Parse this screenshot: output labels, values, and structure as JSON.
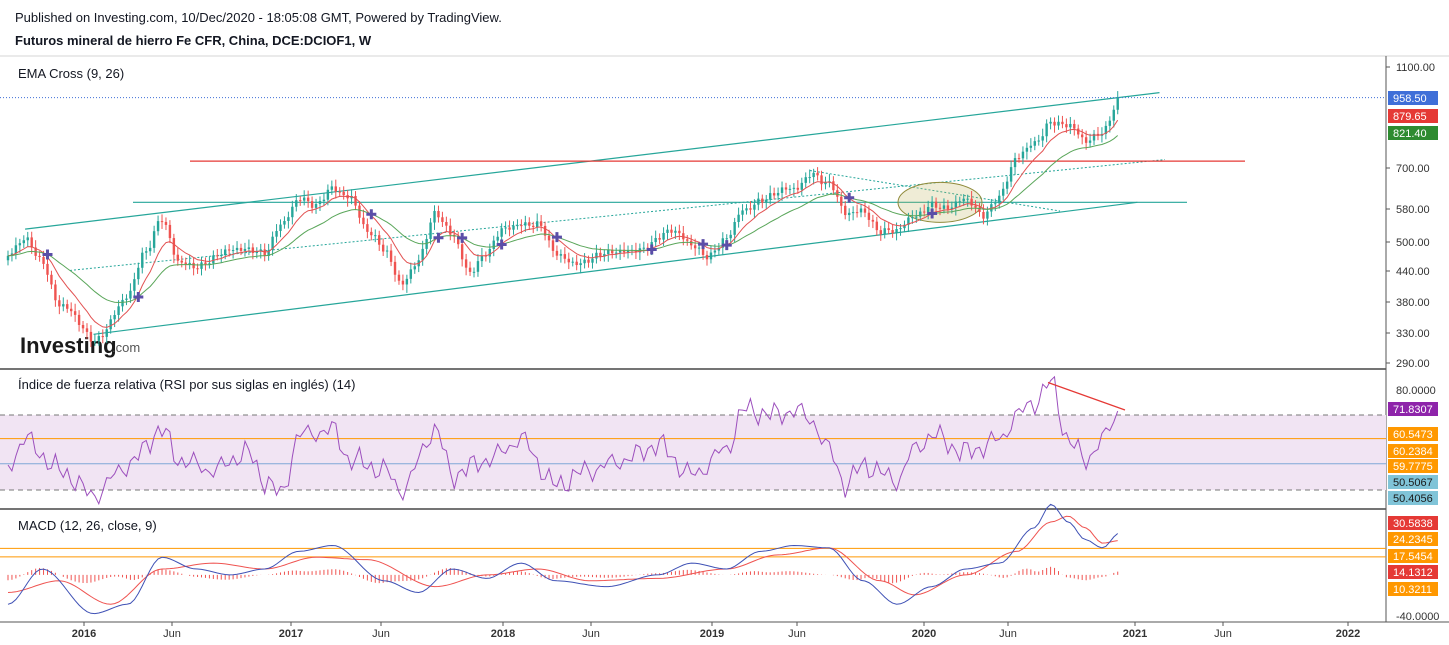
{
  "header": {
    "published": "Published on Investing.com, 10/Dec/2020 - 18:05:08 GMT, Powered by TradingView.",
    "symbol": "Futuros mineral de hierro Fe CFR, China, DCE:DCIOF1, W"
  },
  "watermark": {
    "brand": "Investing",
    "suffix": ".com"
  },
  "colors": {
    "up": "#26a69a",
    "down": "#ef5350",
    "ema_fast": "#e25151",
    "ema_slow": "#5aa65a",
    "channel": "#26a69a",
    "resistance": "#e53935",
    "rsi": "#9c4fbd",
    "rsi_band": "#f1e4f3",
    "macd": "#3f51b5",
    "signal": "#ef5350",
    "hist": "#ef5350",
    "orange": "#ff9800",
    "axis_text": "#333333"
  },
  "panes": {
    "price": {
      "title": "EMA Cross (9, 26)"
    },
    "rsi": {
      "title": "Índice de fuerza relativa (RSI por sus siglas en inglés) (14)"
    },
    "macd": {
      "title": "MACD (12, 26, close, 9)"
    }
  },
  "price_axis": [
    "1100.00",
    "700.00",
    "580.00",
    "500.00",
    "440.00",
    "380.00",
    "330.00",
    "290.00"
  ],
  "price_tags": [
    {
      "value": "958.50",
      "bg": "#3f6fd8",
      "fg": "#ffffff"
    },
    {
      "value": "879.65",
      "bg": "#e53935",
      "fg": "#ffffff"
    },
    {
      "value": "821.40",
      "bg": "#2e8b30",
      "fg": "#ffffff"
    }
  ],
  "rsi_axis": [
    "80.0000"
  ],
  "rsi_tags": [
    {
      "value": "71.8307",
      "bg": "#8e24aa",
      "fg": "#ffffff"
    },
    {
      "value": "60.5473",
      "bg": "#ff9800",
      "fg": "#ffffff"
    },
    {
      "value": "60.2384",
      "bg": "#ff9800",
      "fg": "#ffffff"
    },
    {
      "value": "59.7775",
      "bg": "#ff9800",
      "fg": "#ffffff"
    },
    {
      "value": "50.5067",
      "bg": "#80c4d8",
      "fg": "#1a1a1a"
    },
    {
      "value": "50.4056",
      "bg": "#80c4d8",
      "fg": "#1a1a1a"
    }
  ],
  "macd_axis": [
    "-40.0000"
  ],
  "macd_tags": [
    {
      "value": "30.5838",
      "bg": "#e53935",
      "fg": "#ffffff"
    },
    {
      "value": "24.2345",
      "bg": "#ff9800",
      "fg": "#ffffff"
    },
    {
      "value": "17.5454",
      "bg": "#ff9800",
      "fg": "#ffffff"
    },
    {
      "value": "14.1312",
      "bg": "#e53935",
      "fg": "#ffffff"
    },
    {
      "value": "10.3211",
      "bg": "#ff9800",
      "fg": "#ffffff"
    }
  ],
  "time_axis": [
    {
      "label": "2016",
      "bold": true
    },
    {
      "label": "Jun",
      "bold": false
    },
    {
      "label": "2017",
      "bold": true
    },
    {
      "label": "Jun",
      "bold": false
    },
    {
      "label": "2018",
      "bold": true
    },
    {
      "label": "Jun",
      "bold": false
    },
    {
      "label": "2019",
      "bold": true
    },
    {
      "label": "Jun",
      "bold": false
    },
    {
      "label": "2020",
      "bold": true
    },
    {
      "label": "Jun",
      "bold": false
    },
    {
      "label": "2021",
      "bold": true
    },
    {
      "label": "Jun",
      "bold": false
    },
    {
      "label": "2022",
      "bold": true
    }
  ],
  "chart_data": [
    {
      "type": "candlestick",
      "title": "EMA Cross (9, 26)",
      "x_start": "2015-07",
      "x_end": "2020-12",
      "interval": "W",
      "y_scale": "log",
      "ylim": [
        270,
        1150
      ],
      "close_waypoints": [
        [
          "2015-07",
          470
        ],
        [
          "2015-08",
          500
        ],
        [
          "2015-09",
          460
        ],
        [
          "2015-10",
          380
        ],
        [
          "2015-12",
          320
        ],
        [
          "2016-02",
          390
        ],
        [
          "2016-03",
          470
        ],
        [
          "2016-04",
          560
        ],
        [
          "2016-05",
          460
        ],
        [
          "2016-06",
          440
        ],
        [
          "2016-08",
          490
        ],
        [
          "2016-10",
          470
        ],
        [
          "2016-11",
          550
        ],
        [
          "2016-12",
          610
        ],
        [
          "2017-01",
          580
        ],
        [
          "2017-02",
          640
        ],
        [
          "2017-03",
          620
        ],
        [
          "2017-04",
          520
        ],
        [
          "2017-05",
          480
        ],
        [
          "2017-06",
          420
        ],
        [
          "2017-07",
          460
        ],
        [
          "2017-08",
          560
        ],
        [
          "2017-09",
          520
        ],
        [
          "2017-10",
          440
        ],
        [
          "2017-11",
          470
        ],
        [
          "2017-12",
          530
        ],
        [
          "2018-01",
          550
        ],
        [
          "2018-02",
          540
        ],
        [
          "2018-03",
          470
        ],
        [
          "2018-04",
          460
        ],
        [
          "2018-06",
          470
        ],
        [
          "2018-08",
          490
        ],
        [
          "2018-10",
          520
        ],
        [
          "2018-11",
          500
        ],
        [
          "2018-12",
          470
        ],
        [
          "2019-01",
          500
        ],
        [
          "2019-02",
          580
        ],
        [
          "2019-03",
          610
        ],
        [
          "2019-05",
          630
        ],
        [
          "2019-06",
          690
        ],
        [
          "2019-07",
          650
        ],
        [
          "2019-08",
          560
        ],
        [
          "2019-09",
          580
        ],
        [
          "2019-10",
          530
        ],
        [
          "2019-11",
          520
        ],
        [
          "2019-12",
          560
        ],
        [
          "2020-01",
          600
        ],
        [
          "2020-02",
          580
        ],
        [
          "2020-03",
          600
        ],
        [
          "2020-04",
          570
        ],
        [
          "2020-05",
          620
        ],
        [
          "2020-06",
          720
        ],
        [
          "2020-07",
          780
        ],
        [
          "2020-08",
          870
        ],
        [
          "2020-09",
          840
        ],
        [
          "2020-10",
          780
        ],
        [
          "2020-11",
          830
        ],
        [
          "2020-12",
          958.5
        ]
      ],
      "ema_fast_last": 879.65,
      "ema_slow_last": 821.4,
      "horizontal_lines": [
        {
          "name": "resistance",
          "value": 720
        },
        {
          "name": "support",
          "value": 598
        }
      ],
      "channel": {
        "lower": [
          [
            "2015-12",
            330
          ],
          [
            "2020-11",
            598
          ]
        ],
        "upper": [
          [
            "2015-08",
            530
          ],
          [
            "2020-12",
            980
          ]
        ]
      },
      "last_price": 958.5
    },
    {
      "type": "line",
      "title": "Índice de fuerza relativa (RSI por sus siglas en inglés) (14)",
      "ylim": [
        30,
        90
      ],
      "band": [
        40,
        70
      ],
      "levels": [
        60.5473,
        50.5067
      ],
      "waypoints": [
        [
          "2015-07",
          50
        ],
        [
          "2015-08",
          60
        ],
        [
          "2015-10",
          48
        ],
        [
          "2015-12",
          38
        ],
        [
          "2016-02",
          50
        ],
        [
          "2016-04",
          64
        ],
        [
          "2016-05",
          52
        ],
        [
          "2016-07",
          48
        ],
        [
          "2016-09",
          55
        ],
        [
          "2016-10",
          44
        ],
        [
          "2016-11",
          38
        ],
        [
          "2016-12",
          62
        ],
        [
          "2017-02",
          64
        ],
        [
          "2017-03",
          52
        ],
        [
          "2017-05",
          48
        ],
        [
          "2017-06",
          40
        ],
        [
          "2017-08",
          64
        ],
        [
          "2017-09",
          46
        ],
        [
          "2017-11",
          52
        ],
        [
          "2018-01",
          60
        ],
        [
          "2018-03",
          42
        ],
        [
          "2018-05",
          48
        ],
        [
          "2018-07",
          52
        ],
        [
          "2018-09",
          58
        ],
        [
          "2018-11",
          46
        ],
        [
          "2019-01",
          56
        ],
        [
          "2019-02",
          72
        ],
        [
          "2019-04",
          70
        ],
        [
          "2019-05",
          72
        ],
        [
          "2019-06",
          68
        ],
        [
          "2019-07",
          56
        ],
        [
          "2019-08",
          42
        ],
        [
          "2019-09",
          50
        ],
        [
          "2019-11",
          44
        ],
        [
          "2019-12",
          56
        ],
        [
          "2020-01",
          62
        ],
        [
          "2020-03",
          55
        ],
        [
          "2020-05",
          60
        ],
        [
          "2020-06",
          70
        ],
        [
          "2020-07",
          75
        ],
        [
          "2020-08",
          83
        ],
        [
          "2020-09",
          60
        ],
        [
          "2020-10",
          52
        ],
        [
          "2020-11",
          60
        ],
        [
          "2020-12",
          71.8307
        ]
      ]
    },
    {
      "type": "line",
      "title": "MACD (12, 26, close, 9)",
      "ylim": [
        -45,
        75
      ],
      "levels": [
        17.5454,
        10.3211
      ],
      "macd_waypoints": [
        [
          "2015-07",
          -30
        ],
        [
          "2015-09",
          0
        ],
        [
          "2015-12",
          -38
        ],
        [
          "2016-02",
          -30
        ],
        [
          "2016-04",
          10
        ],
        [
          "2016-06",
          0
        ],
        [
          "2016-08",
          -5
        ],
        [
          "2016-10",
          0
        ],
        [
          "2016-12",
          15
        ],
        [
          "2017-02",
          20
        ],
        [
          "2017-05",
          -10
        ],
        [
          "2017-07",
          -20
        ],
        [
          "2017-09",
          0
        ],
        [
          "2017-11",
          -8
        ],
        [
          "2018-01",
          5
        ],
        [
          "2018-03",
          -10
        ],
        [
          "2018-06",
          -15
        ],
        [
          "2018-09",
          -5
        ],
        [
          "2018-11",
          5
        ],
        [
          "2019-01",
          0
        ],
        [
          "2019-03",
          15
        ],
        [
          "2019-05",
          20
        ],
        [
          "2019-07",
          18
        ],
        [
          "2019-09",
          -10
        ],
        [
          "2019-11",
          -30
        ],
        [
          "2020-01",
          -15
        ],
        [
          "2020-03",
          0
        ],
        [
          "2020-05",
          5
        ],
        [
          "2020-07",
          35
        ],
        [
          "2020-08",
          55
        ],
        [
          "2020-09",
          40
        ],
        [
          "2020-10",
          25
        ],
        [
          "2020-11",
          18
        ],
        [
          "2020-12",
          30.5838
        ]
      ],
      "signal_waypoints": [
        [
          "2015-07",
          -20
        ],
        [
          "2015-10",
          -10
        ],
        [
          "2016-01",
          -30
        ],
        [
          "2016-04",
          0
        ],
        [
          "2016-07",
          5
        ],
        [
          "2016-10",
          0
        ],
        [
          "2017-01",
          10
        ],
        [
          "2017-04",
          8
        ],
        [
          "2017-08",
          -15
        ],
        [
          "2017-11",
          -5
        ],
        [
          "2018-02",
          0
        ],
        [
          "2018-05",
          -10
        ],
        [
          "2018-09",
          -8
        ],
        [
          "2019-01",
          0
        ],
        [
          "2019-04",
          12
        ],
        [
          "2019-07",
          18
        ],
        [
          "2019-10",
          -10
        ],
        [
          "2019-12",
          -22
        ],
        [
          "2020-03",
          -5
        ],
        [
          "2020-06",
          15
        ],
        [
          "2020-08",
          40
        ],
        [
          "2020-09",
          45
        ],
        [
          "2020-10",
          35
        ],
        [
          "2020-11",
          22
        ],
        [
          "2020-12",
          24.2345
        ]
      ]
    }
  ]
}
